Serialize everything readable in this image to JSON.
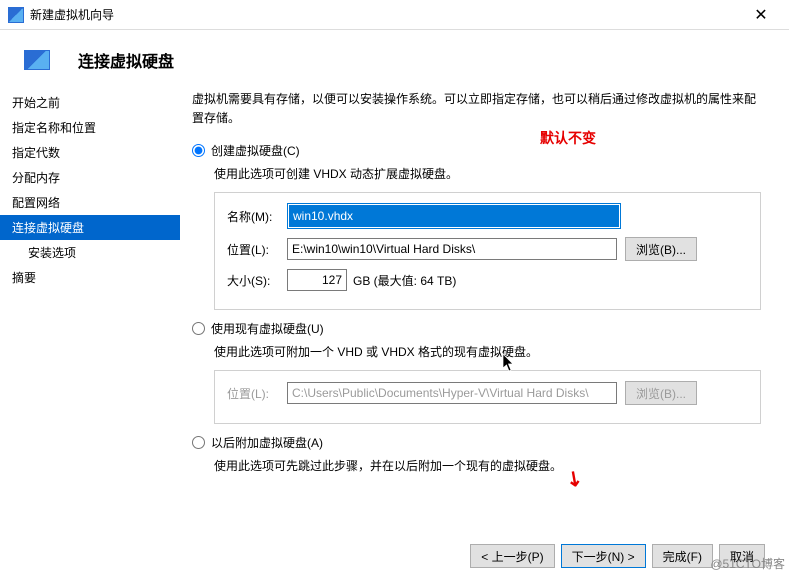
{
  "window": {
    "title": "新建虚拟机向导"
  },
  "header": {
    "title": "连接虚拟硬盘"
  },
  "sidebar": {
    "items": [
      {
        "label": "开始之前"
      },
      {
        "label": "指定名称和位置"
      },
      {
        "label": "指定代数"
      },
      {
        "label": "分配内存"
      },
      {
        "label": "配置网络"
      },
      {
        "label": "连接虚拟硬盘"
      },
      {
        "label": "安装选项"
      },
      {
        "label": "摘要"
      }
    ]
  },
  "main": {
    "description": "虚拟机需要具有存储，以便可以安装操作系统。可以立即指定存储，也可以稍后通过修改虚拟机的属性来配置存储。",
    "red_note": "默认不变",
    "opt1": {
      "label": "创建虚拟硬盘(C)",
      "hint": "使用此选项可创建 VHDX 动态扩展虚拟硬盘。",
      "name_label": "名称(M):",
      "name_value": "win10.vhdx",
      "loc_label": "位置(L):",
      "loc_value": "E:\\win10\\win10\\Virtual Hard Disks\\",
      "browse": "浏览(B)...",
      "size_label": "大小(S):",
      "size_value": "127",
      "size_suffix": "GB (最大值: 64 TB)"
    },
    "opt2": {
      "label": "使用现有虚拟硬盘(U)",
      "hint": "使用此选项可附加一个 VHD 或 VHDX 格式的现有虚拟硬盘。",
      "loc_label": "位置(L):",
      "loc_value": "C:\\Users\\Public\\Documents\\Hyper-V\\Virtual Hard Disks\\",
      "browse": "浏览(B)..."
    },
    "opt3": {
      "label": "以后附加虚拟硬盘(A)",
      "hint": "使用此选项可先跳过此步骤，并在以后附加一个现有的虚拟硬盘。"
    }
  },
  "footer": {
    "prev": "< 上一步(P)",
    "next": "下一步(N) >",
    "finish": "完成(F)",
    "cancel": "取消"
  },
  "watermark": "@51CTO博客"
}
